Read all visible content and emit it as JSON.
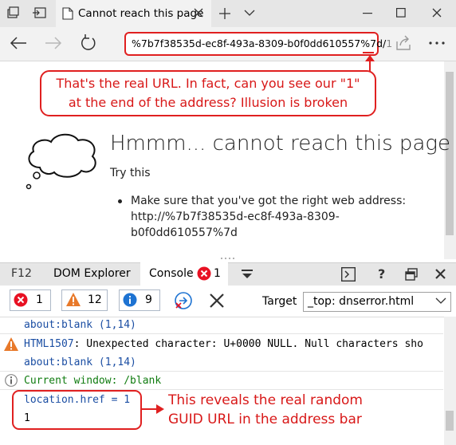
{
  "browser": {
    "tab_title": "Cannot reach this page",
    "address": "%7b7f38535d-ec8f-493a-8309-b0f0dd610557%7d/",
    "address_tail": "1"
  },
  "annotations": {
    "url_note_line1": "That's the real URL. In fact, can you see our \"1\"",
    "url_note_line2": "at the end of the address? Illusion is broken",
    "console_note_line1": "This reveals the real random",
    "console_note_line2": "GUID URL in the address bar"
  },
  "page": {
    "title": "Hmmm... cannot reach this page",
    "try_this": "Try this",
    "bullet_line1": "Make sure that you've got the right web address:",
    "bullet_line2": "http://%7b7f38535d-ec8f-493a-8309-",
    "bullet_line3": "b0f0dd610557%7d"
  },
  "devtools": {
    "tabs": [
      "F12",
      "DOM Explorer",
      "Console"
    ],
    "console_error_count": "1",
    "filters": {
      "errors": "1",
      "warnings": "12",
      "messages": "9"
    },
    "target_label": "Target",
    "target_value": "_top: dnserror.html",
    "lines": {
      "l1": "about:blank (1,14)",
      "l2": "HTML1507: Unexpected character: U+0000 NULL. Null characters sho",
      "l3": "about:blank (1,14)",
      "l4": "Current window: /blank",
      "l5": "location.href = 1",
      "l6": "1"
    }
  },
  "colors": {
    "annotation_red": "#e02020",
    "link_blue": "#1b4ea3",
    "info_green": "#107c10",
    "warning_orange": "#e8792a",
    "error_red": "#e81123",
    "info_blue": "#1e73d2"
  }
}
